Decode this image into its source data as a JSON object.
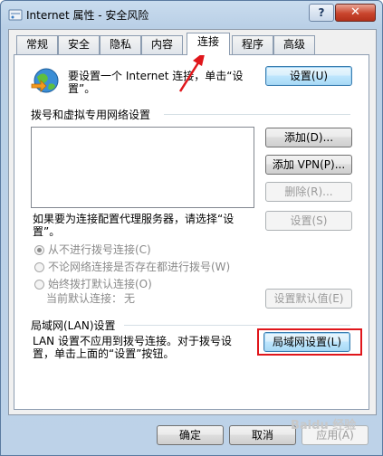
{
  "window": {
    "title": "Internet 属性 - 安全风险"
  },
  "titlebar": {
    "help_label": "?",
    "close_label": "✕"
  },
  "tabs": [
    "常规",
    "安全",
    "隐私",
    "内容",
    "连接",
    "程序",
    "高级"
  ],
  "active_tab": "连接",
  "setup": {
    "text": "要设置一个 Internet 连接，单击“设置”。",
    "line1": "要设置一个 Internet 连接，单击“设",
    "line2": "置”。",
    "button": "设置(U)"
  },
  "dialup": {
    "section_title": "拨号和虚拟专用网络设置",
    "add_button": "添加(D)...",
    "add_vpn_button": "添加 VPN(P)...",
    "delete_button": "删除(R)...",
    "proxy_line1": "如果要为连接配置代理服务器，请选择“设",
    "proxy_line2": "置”。",
    "settings_button": "设置(S)",
    "radio_never": "从不进行拨号连接(C)",
    "radio_no_network": "不论网络连接是否存在都进行拨号(W)",
    "radio_always": "始终拨打默认连接(O)",
    "current_default_label": "当前默认连接：",
    "current_default_value": "无",
    "set_default_button": "设置默认值(E)"
  },
  "lan": {
    "section_title": "局域网(LAN)设置",
    "line1": "LAN 设置不应用到拨号连接。对于拨号设",
    "line2": "置，单击上面的“设置”按钮。",
    "button": "局域网设置(L)"
  },
  "footer": {
    "ok": "确定",
    "cancel": "取消",
    "apply": "应用(A)"
  },
  "watermark": "Baidu 经验",
  "colors": {
    "highlight_box": "#e0161b",
    "arrow": "#e0161b"
  }
}
